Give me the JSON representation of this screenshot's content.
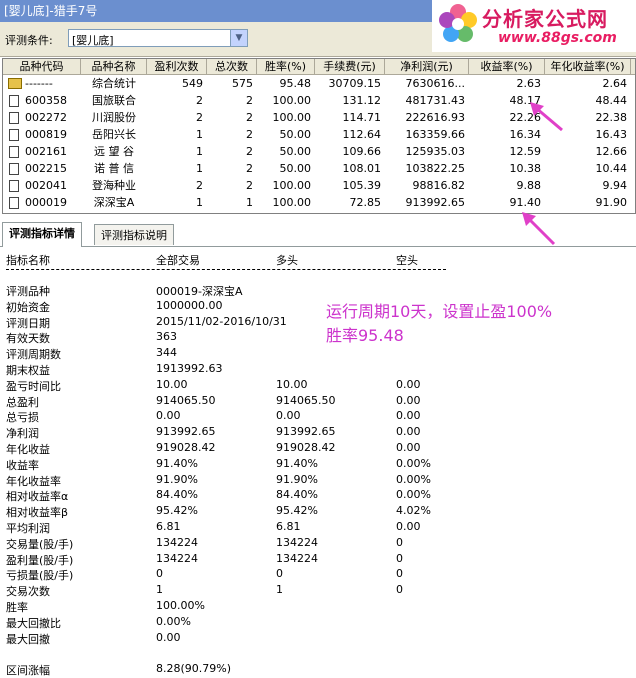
{
  "window": {
    "title": "[婴儿底]-猎手7号"
  },
  "logo": {
    "brand": "分析家公式网",
    "url": "www.88gs.com"
  },
  "condition": {
    "label": "评测条件:",
    "value": "[婴儿底]"
  },
  "grid": {
    "columns": [
      "品种代码",
      "品种名称",
      "盈利次数",
      "总次数",
      "胜率(%)",
      "手续费(元)",
      "净利润(元)",
      "收益率(%)",
      "年化收益率(%)",
      "相"
    ],
    "rows": [
      {
        "code": "-------",
        "name": "综合统计",
        "wins": "549",
        "total": "575",
        "rate": "95.48",
        "fee": "30709.15",
        "profit": "7630616...",
        "ret": "2.63",
        "annual": "2.64",
        "summary": true
      },
      {
        "code": "600358",
        "name": "国旅联合",
        "wins": "2",
        "total": "2",
        "rate": "100.00",
        "fee": "131.12",
        "profit": "481731.43",
        "ret": "48.17",
        "annual": "48.44"
      },
      {
        "code": "002272",
        "name": "川润股份",
        "wins": "2",
        "total": "2",
        "rate": "100.00",
        "fee": "114.71",
        "profit": "222616.93",
        "ret": "22.26",
        "annual": "22.38"
      },
      {
        "code": "000819",
        "name": "岳阳兴长",
        "wins": "1",
        "total": "2",
        "rate": "50.00",
        "fee": "112.64",
        "profit": "163359.66",
        "ret": "16.34",
        "annual": "16.43"
      },
      {
        "code": "002161",
        "name": "远 望 谷",
        "wins": "1",
        "total": "2",
        "rate": "50.00",
        "fee": "109.66",
        "profit": "125935.03",
        "ret": "12.59",
        "annual": "12.66"
      },
      {
        "code": "002215",
        "name": "诺 普 信",
        "wins": "1",
        "total": "2",
        "rate": "50.00",
        "fee": "108.01",
        "profit": "103822.25",
        "ret": "10.38",
        "annual": "10.44"
      },
      {
        "code": "002041",
        "name": "登海种业",
        "wins": "2",
        "total": "2",
        "rate": "100.00",
        "fee": "105.39",
        "profit": "98816.82",
        "ret": "9.88",
        "annual": "9.94"
      },
      {
        "code": "000019",
        "name": "深深宝A",
        "wins": "1",
        "total": "1",
        "rate": "100.00",
        "fee": "72.85",
        "profit": "913992.65",
        "ret": "91.40",
        "annual": "91.90"
      }
    ]
  },
  "tabs": [
    "评测指标详情",
    "评测指标说明"
  ],
  "detail": {
    "headers": [
      "指标名称",
      "全部交易",
      "多头",
      "空头"
    ],
    "rows": [
      {
        "label": "评测品种",
        "all": "000019-深深宝A",
        "long": "",
        "short": ""
      },
      {
        "label": "初始资金",
        "all": "1000000.00",
        "long": "",
        "short": ""
      },
      {
        "label": "评测日期",
        "all": "2015/11/02-2016/10/31",
        "long": "",
        "short": ""
      },
      {
        "label": "有效天数",
        "all": "363",
        "long": "",
        "short": ""
      },
      {
        "label": "评测周期数",
        "all": "344",
        "long": "",
        "short": ""
      },
      {
        "label": "期末权益",
        "all": "1913992.63",
        "long": "",
        "short": ""
      },
      {
        "label": "盈亏时间比",
        "all": "10.00",
        "long": "10.00",
        "short": "0.00"
      },
      {
        "label": "总盈利",
        "all": "914065.50",
        "long": "914065.50",
        "short": "0.00"
      },
      {
        "label": "总亏损",
        "all": "0.00",
        "long": "0.00",
        "short": "0.00"
      },
      {
        "label": "净利润",
        "all": "913992.65",
        "long": "913992.65",
        "short": "0.00"
      },
      {
        "label": "年化收益",
        "all": "919028.42",
        "long": "919028.42",
        "short": "0.00"
      },
      {
        "label": "收益率",
        "all": "91.40%",
        "long": "91.40%",
        "short": "0.00%"
      },
      {
        "label": "年化收益率",
        "all": "91.90%",
        "long": "91.90%",
        "short": "0.00%"
      },
      {
        "label": "相对收益率α",
        "all": "84.40%",
        "long": "84.40%",
        "short": "0.00%"
      },
      {
        "label": "相对收益率β",
        "all": "95.42%",
        "long": "95.42%",
        "short": "4.02%"
      },
      {
        "label": "平均利润",
        "all": "6.81",
        "long": "6.81",
        "short": "0.00"
      },
      {
        "label": "交易量(股/手)",
        "all": "134224",
        "long": "134224",
        "short": "0"
      },
      {
        "label": "盈利量(股/手)",
        "all": "134224",
        "long": "134224",
        "short": "0"
      },
      {
        "label": "亏损量(股/手)",
        "all": "0",
        "long": "0",
        "short": "0"
      },
      {
        "label": "交易次数",
        "all": "1",
        "long": "1",
        "short": "0"
      },
      {
        "label": "胜率",
        "all": "100.00%",
        "long": "",
        "short": ""
      },
      {
        "label": "最大回撤比",
        "all": "0.00%",
        "long": "",
        "short": ""
      },
      {
        "label": "最大回撤",
        "all": "0.00",
        "long": "",
        "short": ""
      },
      {
        "label": "",
        "all": "",
        "long": "",
        "short": ""
      },
      {
        "label": "区间涨幅",
        "all": "8.28(90.79%)",
        "long": "",
        "short": ""
      }
    ]
  },
  "annotation": {
    "line1": "运行周期10天，设置止盈100%",
    "line2": "胜率95.48"
  },
  "colors": {
    "titlebar": "#6b8fcf",
    "annotation": "#cc33cc",
    "arrow": "#e040c8"
  }
}
